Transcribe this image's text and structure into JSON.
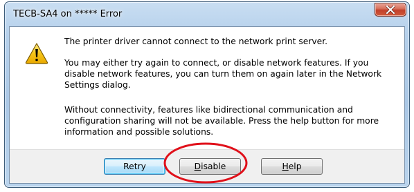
{
  "window": {
    "title": "TECB-SA4 on ***** Error",
    "close_icon": "close-icon"
  },
  "icon": {
    "name": "warning-icon",
    "colors": {
      "fill": "#f5c518",
      "outline": "#7a5a00",
      "glyph": "#000000"
    }
  },
  "messages": {
    "line1": "The printer driver cannot connect to the network print server.",
    "line2": "You may either try again to connect, or disable network features.  If you disable network features, you can turn them on again later in the Network Settings dialog.",
    "line3": "Without connectivity, features like bidirectional communication and configuration sharing will not be available.  Press the help button for more information and possible solutions."
  },
  "buttons": {
    "retry": {
      "label": "Retry",
      "is_default": true
    },
    "disable": {
      "mnemonic": "D",
      "label_rest": "isable"
    },
    "help": {
      "mnemonic": "H",
      "label_rest": "elp"
    }
  },
  "annotation": {
    "shape": "ellipse",
    "color": "#e0101a",
    "target": "disable-button"
  }
}
